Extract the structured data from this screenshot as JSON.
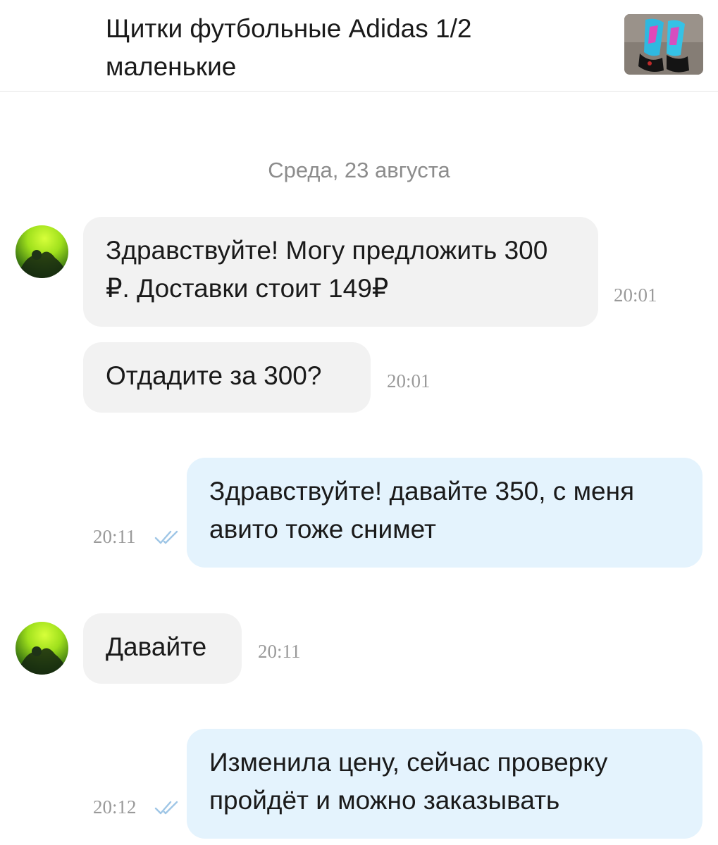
{
  "header": {
    "title": "Щитки футбольные Adidas 1/2 маленькие",
    "thumbnail_icon": "shin-guards-photo"
  },
  "chat": {
    "date_separator": "Среда, 23 августа",
    "messages": [
      {
        "direction": "incoming",
        "text": "Здравствуйте! Могу предложить 300 ₽. Доставки стоит 149₽",
        "time": "20:01"
      },
      {
        "direction": "incoming",
        "text": "Отдадите за 300?",
        "time": "20:01"
      },
      {
        "direction": "outgoing",
        "text": "Здравствуйте! давайте 350, с меня авито тоже снимет",
        "time": "20:11",
        "status_icon": "double-check-icon"
      },
      {
        "direction": "incoming",
        "text": "Давайте",
        "time": "20:11"
      },
      {
        "direction": "outgoing",
        "text": "Изменила цену, сейчас проверку пройдёт и можно заказывать",
        "time": "20:12",
        "status_icon": "double-check-icon"
      }
    ]
  },
  "colors": {
    "incoming_bubble": "#f2f2f2",
    "outgoing_bubble": "#e4f3fd",
    "read_check": "#9fc6e6",
    "timestamp": "#9a9a9a"
  }
}
